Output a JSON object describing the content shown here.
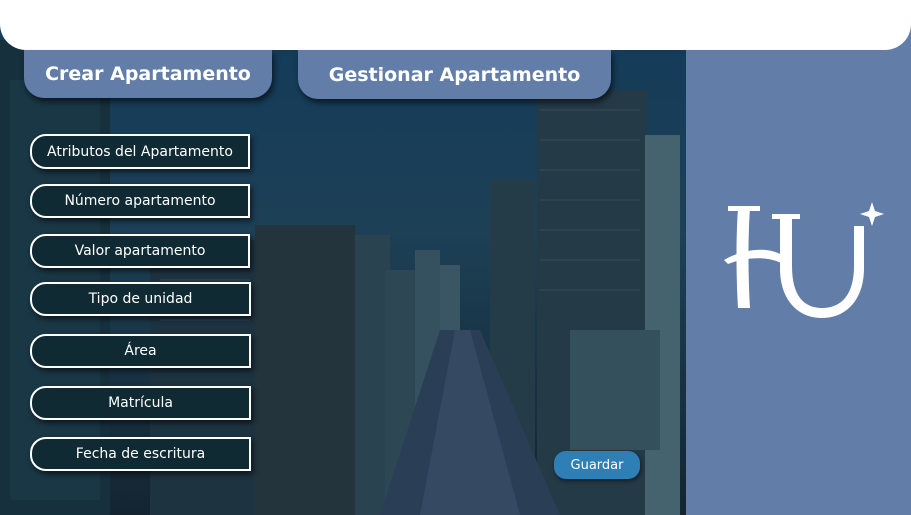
{
  "tabs": {
    "crear": "Crear Apartamento",
    "gestionar": "Gestionar Apartamento"
  },
  "fields": [
    "Atributos del Apartamento",
    "Número apartamento",
    "Valor apartamento",
    "Tipo de unidad",
    "Área",
    "Matrícula",
    "Fecha de escritura"
  ],
  "actions": {
    "save_label": "Guardar"
  },
  "colors": {
    "accent": "#627ea8",
    "field_bg": "#0f2a33",
    "save_button": "#2e7fb6",
    "top_bar": "#ffffff"
  },
  "logo": {
    "icon": "hu-monogram-logo"
  },
  "background": {
    "icon": "city-skyline-image"
  }
}
